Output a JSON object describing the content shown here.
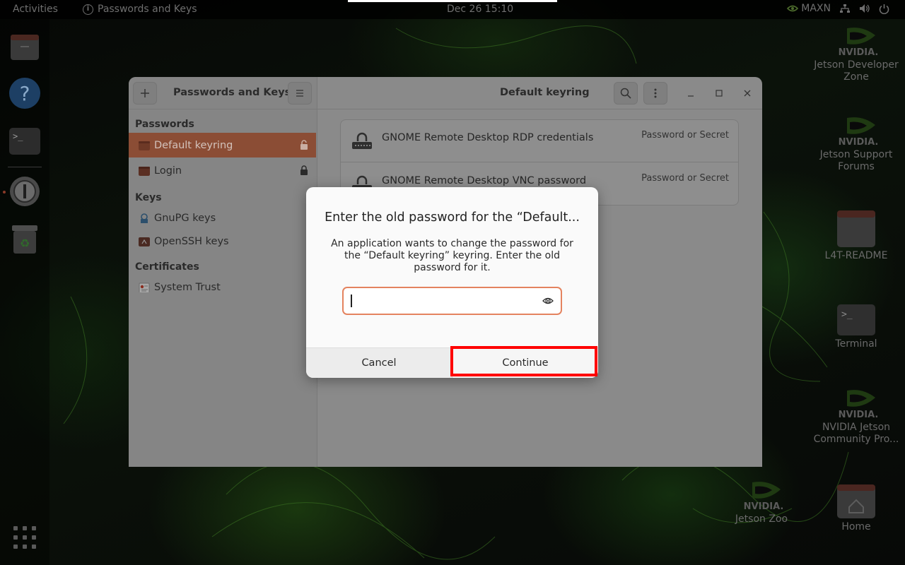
{
  "topbar": {
    "activities": "Activities",
    "app_name": "Passwords and Keys",
    "clock": "Dec 26  15:10",
    "power_mode": "MAXN"
  },
  "desktop_icons": [
    {
      "label": "Jetson Developer Zone",
      "icon": "nvidia-logo-icon"
    },
    {
      "label": "Jetson Support Forums",
      "icon": "nvidia-logo-icon"
    },
    {
      "label": "L4T-README",
      "icon": "folder-icon"
    },
    {
      "label": "Terminal",
      "icon": "terminal-icon"
    },
    {
      "label": "NVIDIA Jetson Community Pro...",
      "icon": "nvidia-logo-icon"
    },
    {
      "label": "Jetson Zoo",
      "icon": "nvidia-logo-icon"
    },
    {
      "label": "Home",
      "icon": "home-folder-icon"
    }
  ],
  "window": {
    "sidebar_title": "Passwords and Keys",
    "content_title": "Default keyring",
    "sections": {
      "passwords": "Passwords",
      "keys": "Keys",
      "certificates": "Certificates"
    },
    "password_items": [
      {
        "label": "Default keyring",
        "active": true
      },
      {
        "label": "Login",
        "active": false
      }
    ],
    "key_items": [
      {
        "label": "GnuPG keys"
      },
      {
        "label": "OpenSSH keys"
      }
    ],
    "certificate_items": [
      {
        "label": "System Trust"
      }
    ],
    "entries": [
      {
        "name": "GNOME Remote Desktop RDP credentials",
        "type": "Password or Secret"
      },
      {
        "name": "GNOME Remote Desktop VNC password",
        "type": "Password or Secret"
      }
    ]
  },
  "dialog": {
    "title": "Enter the old password for the “Default...",
    "body": "An application wants to change the password for the “Default keyring” keyring. Enter the old password for it.",
    "password_value": "",
    "cancel_label": "Cancel",
    "continue_label": "Continue"
  },
  "colors": {
    "accent": "#e4835f",
    "selection": "#8b4d35",
    "highlight_box": "#ff0000"
  }
}
